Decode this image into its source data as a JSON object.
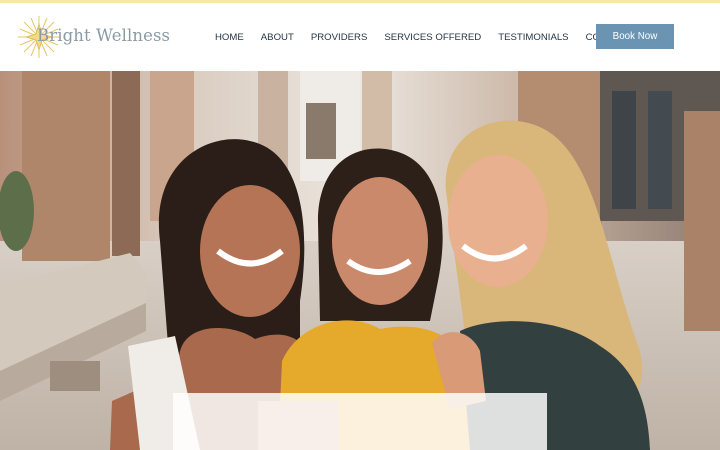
{
  "brand": {
    "name": "Bright Wellness",
    "accent": "#6b94b2",
    "logo_color": "#e6c262",
    "top_strip": "#f7e7a8"
  },
  "nav": {
    "items": [
      {
        "label": "HOME"
      },
      {
        "label": "ABOUT"
      },
      {
        "label": "PROVIDERS"
      },
      {
        "label": "SERVICES OFFERED"
      },
      {
        "label": "TESTIMONIALS"
      },
      {
        "label": "CONTACT"
      }
    ],
    "cta_label": "Book Now"
  },
  "hero": {
    "image": "photo-of-three-smiling-women",
    "card_text": ""
  }
}
